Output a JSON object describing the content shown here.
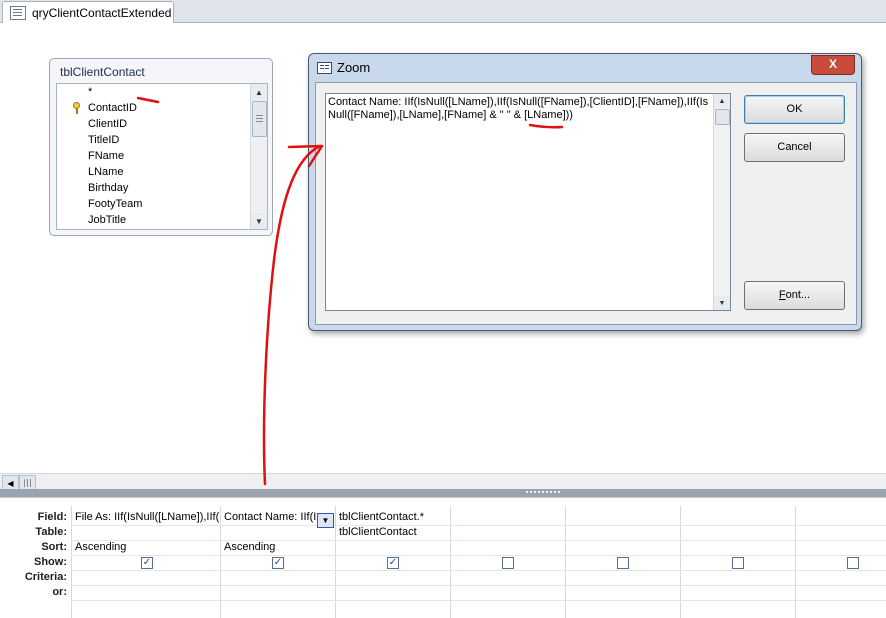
{
  "tab": {
    "label": "qryClientContactExtended"
  },
  "table": {
    "name": "tblClientContact",
    "fields": [
      "*",
      "ContactID",
      "ClientID",
      "TitleID",
      "FName",
      "LName",
      "Birthday",
      "FootyTeam",
      "JobTitle"
    ],
    "key_field": "ContactID"
  },
  "zoom": {
    "title": "Zoom",
    "close": "X",
    "expression": "Contact Name: IIf(IsNull([LName]),IIf(IsNull([FName]),[ClientID],[FName]),IIf(IsNull([FName]),[LName],[FName] & \" \" & [LName]))",
    "ok_label": "OK",
    "cancel_label": "Cancel",
    "font_label_prefix": "F",
    "font_label_rest": "ont..."
  },
  "grid": {
    "row_labels": [
      "Field:",
      "Table:",
      "Sort:",
      "Show:",
      "Criteria:",
      "or:"
    ],
    "columns": [
      {
        "field": "File As: IIf(IsNull([LName]),IIf(",
        "table": "",
        "sort": "Ascending",
        "show": true
      },
      {
        "field": "Contact Name: IIf(I",
        "table": "",
        "sort": "Ascending",
        "show": true
      },
      {
        "field": "tblClientContact.*",
        "table": "tblClientContact",
        "sort": "",
        "show": true
      },
      {
        "field": "",
        "table": "",
        "sort": "",
        "show": false
      },
      {
        "field": "",
        "table": "",
        "sort": "",
        "show": false
      },
      {
        "field": "",
        "table": "",
        "sort": "",
        "show": false
      },
      {
        "field": "",
        "table": "",
        "sort": "",
        "show": false
      }
    ]
  },
  "colors": {
    "annotation": "#e01010",
    "dialog_frame": "#c9d9ec",
    "close_button": "#c84b3c"
  }
}
